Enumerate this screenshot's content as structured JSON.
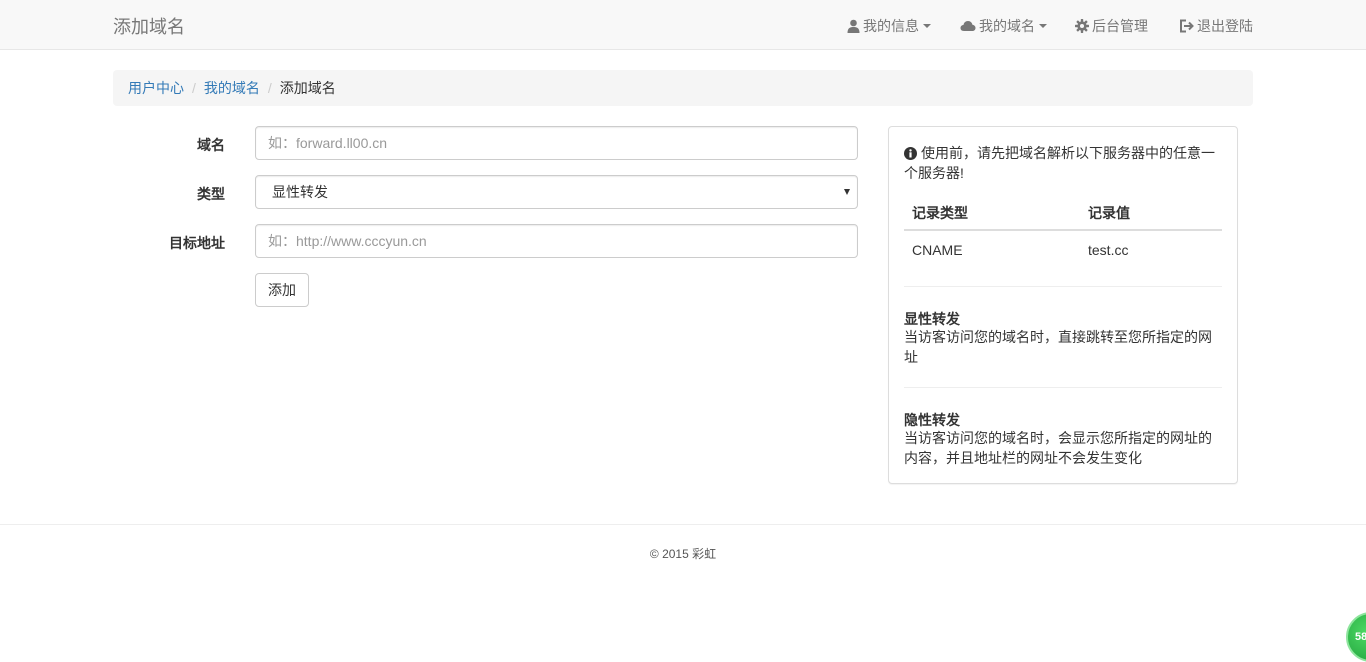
{
  "navbar": {
    "brand": "添加域名",
    "items": [
      {
        "label": "我的信息",
        "icon": "user-icon",
        "dropdown": true
      },
      {
        "label": "我的域名",
        "icon": "cloud-icon",
        "dropdown": true
      },
      {
        "label": "后台管理",
        "icon": "gear-icon",
        "dropdown": false
      },
      {
        "label": "退出登陆",
        "icon": "logout-icon",
        "dropdown": false
      }
    ]
  },
  "breadcrumb": {
    "items": [
      "用户中心",
      "我的域名"
    ],
    "active": "添加域名",
    "separator": "/"
  },
  "form": {
    "domain": {
      "label": "域名",
      "placeholder": "如：forward.ll00.cn",
      "value": ""
    },
    "type": {
      "label": "类型",
      "selected": "显性转发"
    },
    "target": {
      "label": "目标地址",
      "placeholder": "如：http://www.cccyun.cn",
      "value": ""
    },
    "submit_label": "添加"
  },
  "info_panel": {
    "intro": "使用前，请先把域名解析以下服务器中的任意一个服务器!",
    "table": {
      "headers": [
        "记录类型",
        "记录值"
      ],
      "rows": [
        [
          "CNAME",
          "test.cc"
        ]
      ]
    },
    "explicit": {
      "title": "显性转发",
      "desc": "当访客访问您的域名时，直接跳转至您所指定的网址"
    },
    "implicit": {
      "title": "隐性转发",
      "desc": "当访客访问您的域名时，会显示您所指定的网址的内容，并且地址栏的网址不会发生变化"
    }
  },
  "footer": {
    "text": "© 2015 彩虹"
  },
  "float_badge": {
    "text": "58"
  },
  "colors": {
    "link": "#337ab7",
    "navbar_bg": "#f8f8f8",
    "breadcrumb_bg": "#f5f5f5"
  }
}
